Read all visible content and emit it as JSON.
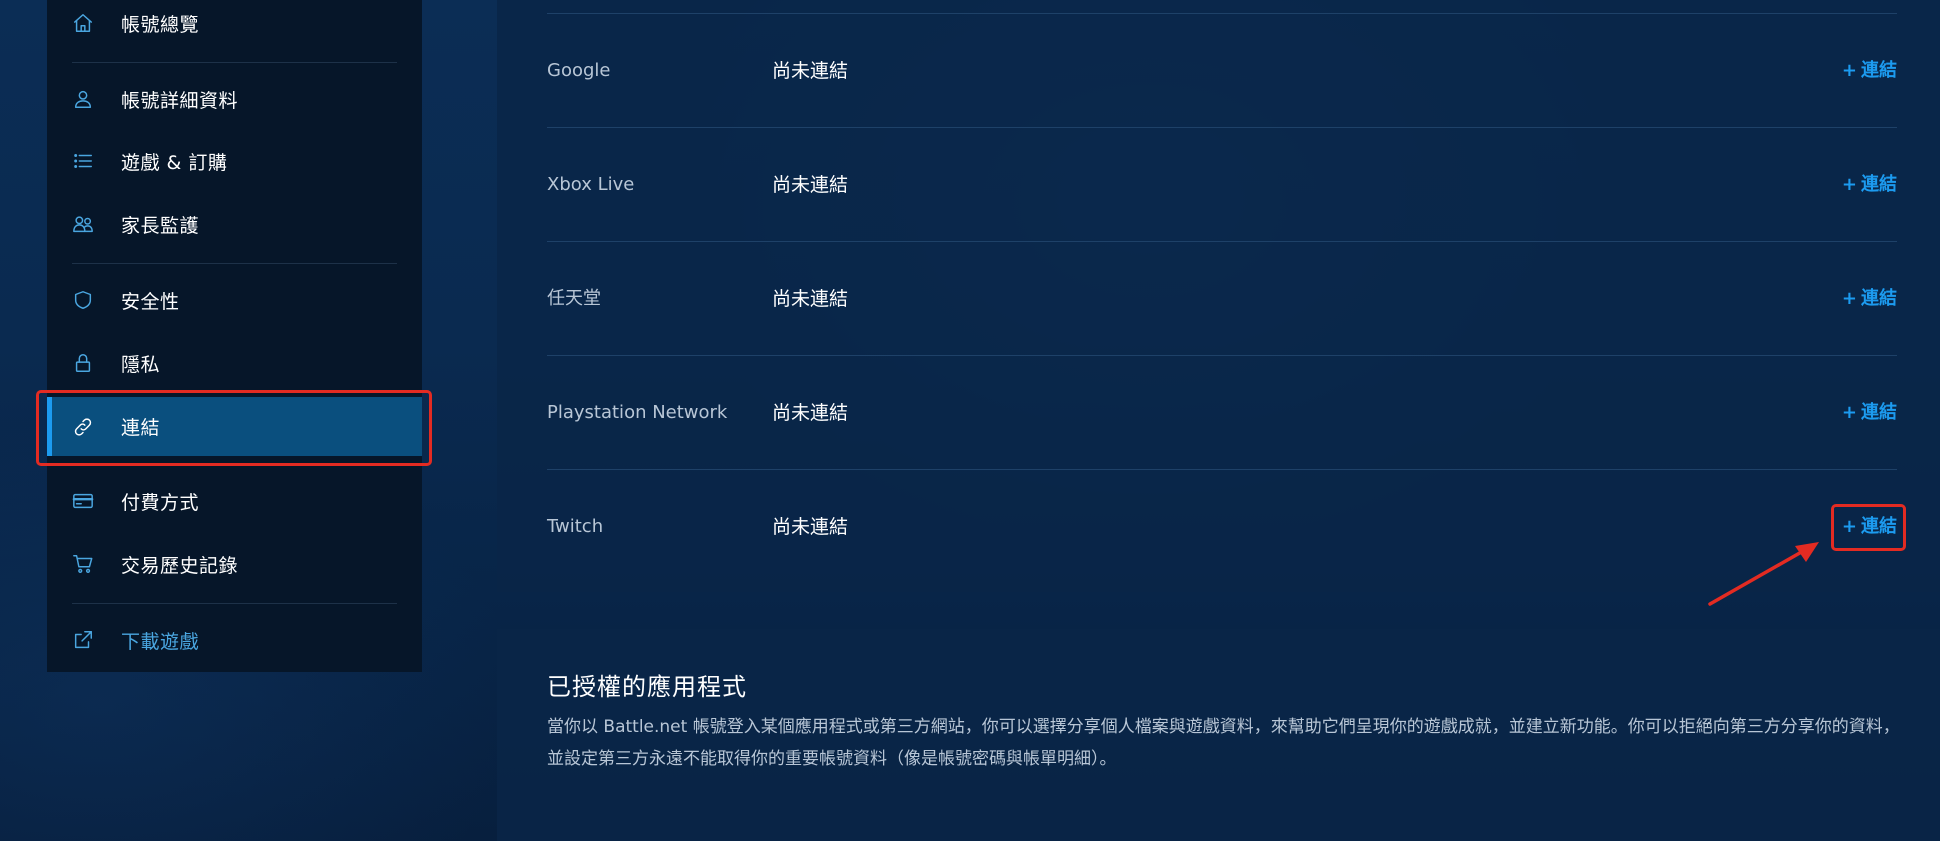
{
  "sidebar": {
    "items": [
      {
        "label": "帳號總覽",
        "icon": "home-icon"
      },
      {
        "label": "帳號詳細資料",
        "icon": "user-icon"
      },
      {
        "label": "遊戲 & 訂購",
        "icon": "list-icon"
      },
      {
        "label": "家長監護",
        "icon": "users-icon"
      },
      {
        "label": "安全性",
        "icon": "shield-icon"
      },
      {
        "label": "隱私",
        "icon": "lock-icon"
      },
      {
        "label": "連結",
        "icon": "link-icon",
        "active": true
      },
      {
        "label": "付費方式",
        "icon": "credit-card-icon"
      },
      {
        "label": "交易歷史記錄",
        "icon": "cart-icon"
      },
      {
        "label": "下載遊戲",
        "icon": "external-link-icon"
      }
    ]
  },
  "connections": {
    "rows": [
      {
        "service": "Google",
        "status": "尚未連結",
        "action": "連結"
      },
      {
        "service": "Xbox Live",
        "status": "尚未連結",
        "action": "連結"
      },
      {
        "service": "任天堂",
        "status": "尚未連結",
        "action": "連結"
      },
      {
        "service": "Playstation Network",
        "status": "尚未連結",
        "action": "連結"
      },
      {
        "service": "Twitch",
        "status": "尚未連結",
        "action": "連結"
      }
    ],
    "plus_symbol": "+"
  },
  "authorized_apps": {
    "title": "已授權的應用程式",
    "description": "當你以 Battle.net 帳號登入某個應用程式或第三方網站，你可以選擇分享個人檔案與遊戲資料，來幫助它們呈現你的遊戲成就，並建立新功能。你可以拒絕向第三方分享你的資料，並設定第三方永遠不能取得你的重要帳號資料（像是帳號密碼與帳單明細）。"
  },
  "colors": {
    "accent": "#1c9bf0",
    "highlight": "#e32b22",
    "active_bg": "#0a4f7e"
  }
}
